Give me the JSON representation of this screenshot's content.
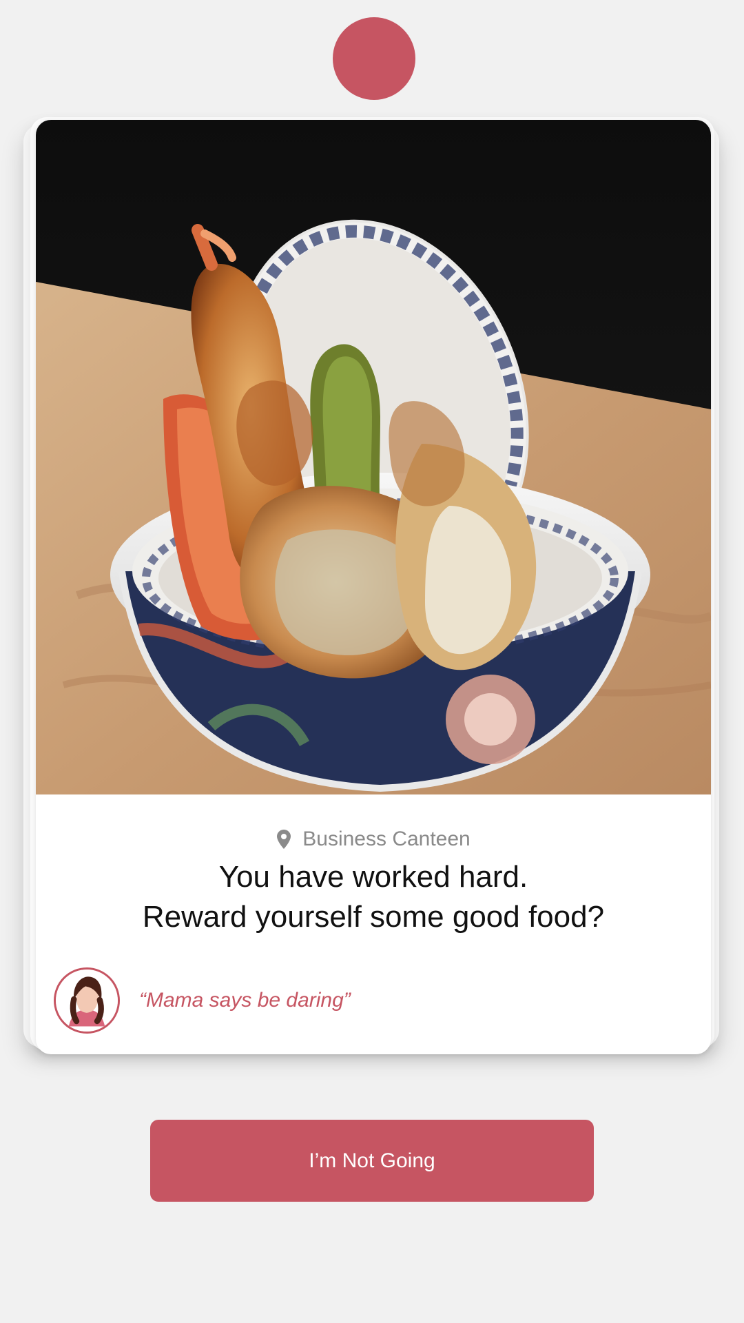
{
  "header": {
    "indicator": "red-dot"
  },
  "card": {
    "photo_icon": "food-photo",
    "location": {
      "icon": "location-pin-icon",
      "label": "Business Canteen"
    },
    "headline": {
      "line1": "You have worked hard.",
      "line2": "Reward yourself some good food?"
    },
    "persona": {
      "avatar_icon": "woman-avatar-icon",
      "quote": "“Mama says be daring”"
    }
  },
  "actions": {
    "primary_label": "I’m Not Going"
  },
  "colors": {
    "accent": "#c65562",
    "background": "#f1f1f1",
    "card": "#ffffff",
    "muted_text": "#8a8a8a",
    "text": "#111111"
  }
}
